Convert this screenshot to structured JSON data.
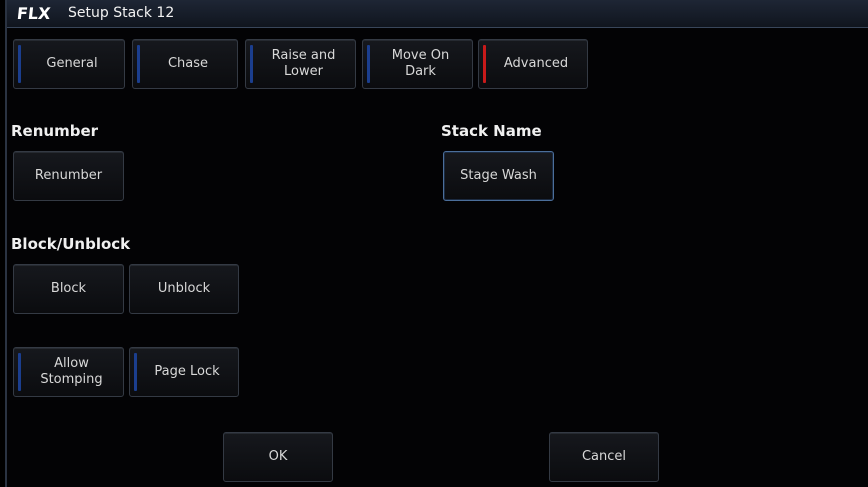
{
  "window": {
    "logo": "FLX",
    "title": "Setup Stack 12"
  },
  "tabs": [
    {
      "label": "General"
    },
    {
      "label": "Chase"
    },
    {
      "label": "Raise and\nLower"
    },
    {
      "label": "Move On\nDark"
    },
    {
      "label": "Advanced"
    }
  ],
  "renumber": {
    "heading": "Renumber",
    "button": "Renumber"
  },
  "stack_name": {
    "heading": "Stack Name",
    "value": "Stage Wash"
  },
  "block": {
    "heading": "Block/Unblock",
    "block_button": "Block",
    "unblock_button": "Unblock"
  },
  "toggles": {
    "allow_stomping": "Allow\nStomping",
    "page_lock": "Page Lock"
  },
  "footer": {
    "ok": "OK",
    "cancel": "Cancel"
  },
  "colors": {
    "indicator_blue": "#1b3e8e",
    "indicator_red": "#c81a1a",
    "selected_border": "#4b6e9a"
  }
}
